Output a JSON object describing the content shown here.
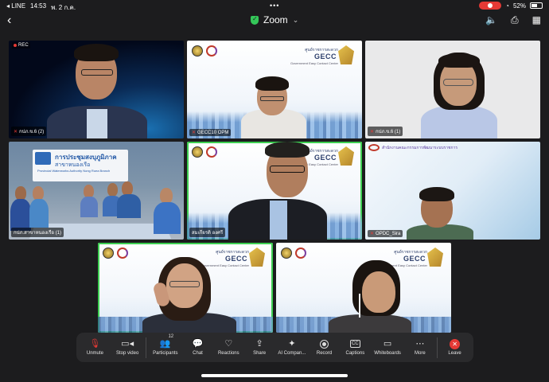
{
  "status_bar": {
    "back_app": "◂ LINE",
    "time": "14:53",
    "date": "พ. 2 ก.ค.",
    "battery": "52%"
  },
  "header": {
    "title": "Zoom"
  },
  "tiles": [
    {
      "name": "กปภ.ข.6 (2)",
      "rec_label": "REC"
    },
    {
      "name": "GECC10 OPM"
    },
    {
      "name": "กปภ.ข.6 (1)"
    },
    {
      "name": "กปภ.สาขาหนองเรือ (1)",
      "sign_title": "การประชุมสงบุภูมิภาค",
      "sign_sub": "สาขาหนองเรือ",
      "sign_en": "Provincial Waterworks Authority Nong Ruea Branch"
    },
    {
      "name": "สมเกียรติ องศรี"
    },
    {
      "name": "OPDC_Sira",
      "org": "สำนักงานคณะกรรมการพัฒนาระบบราชการ"
    },
    {
      "name": ""
    },
    {
      "name": ""
    }
  ],
  "gecc": {
    "org": "ศูนย์ราชการสะดวก",
    "title": "GECC",
    "sub": "Government Easy Contact Center"
  },
  "toolbar": {
    "unmute": "Unmute",
    "stop_video": "Stop video",
    "participants": "Participants",
    "participants_count": "12",
    "chat": "Chat",
    "reactions": "Reactions",
    "share": "Share",
    "ai_companion": "AI Compan...",
    "record": "Record",
    "captions": "Captions",
    "captions_icon": "CC",
    "whiteboards": "Whiteboards",
    "more": "More",
    "leave": "Leave"
  }
}
